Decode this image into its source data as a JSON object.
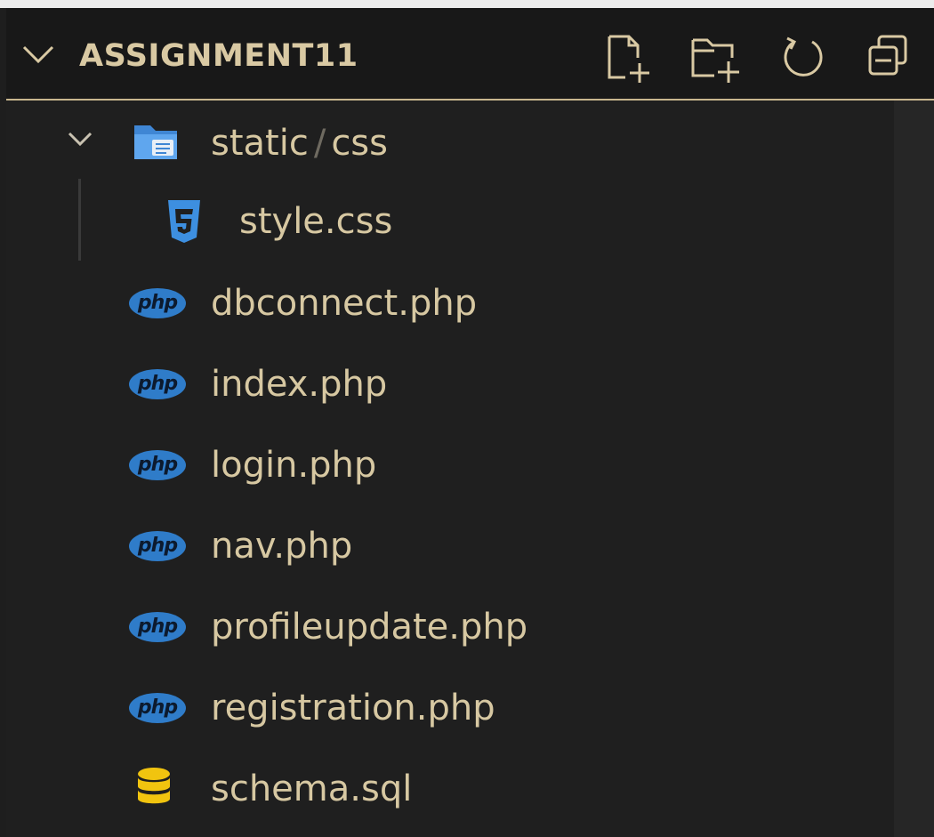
{
  "explorer": {
    "title": "ASSIGNMENT11",
    "actions": [
      {
        "name": "new-file",
        "icon": "new-file-icon"
      },
      {
        "name": "new-folder",
        "icon": "new-folder-icon"
      },
      {
        "name": "refresh",
        "icon": "refresh-icon"
      },
      {
        "name": "collapse-all",
        "icon": "collapse-all-icon"
      }
    ]
  },
  "tree": {
    "folder": {
      "name_part1": "static",
      "separator": "/",
      "name_part2": "css",
      "icon": "folder-icon",
      "expanded": true
    },
    "files": [
      {
        "label": "style.css",
        "icon": "css-icon",
        "indent": 1
      },
      {
        "label": "dbconnect.php",
        "icon": "php-icon",
        "indent": 0
      },
      {
        "label": "index.php",
        "icon": "php-icon",
        "indent": 0
      },
      {
        "label": "login.php",
        "icon": "php-icon",
        "indent": 0
      },
      {
        "label": "nav.php",
        "icon": "php-icon",
        "indent": 0
      },
      {
        "label": "profileupdate.php",
        "icon": "php-icon",
        "indent": 0
      },
      {
        "label": "registration.php",
        "icon": "php-icon",
        "indent": 0
      },
      {
        "label": "schema.sql",
        "icon": "database-icon",
        "indent": 0
      }
    ],
    "php_badge_text": "php"
  },
  "colors": {
    "sidebar_bg": "#1f1f1f",
    "header_bg": "#181818",
    "accent_border": "#c8b68e",
    "text": "#d7c8a2",
    "folder_blue": "#4f9be8",
    "css_blue": "#3d8fe0",
    "php_blue": "#2f7cc9",
    "sql_yellow": "#f1c40f"
  }
}
